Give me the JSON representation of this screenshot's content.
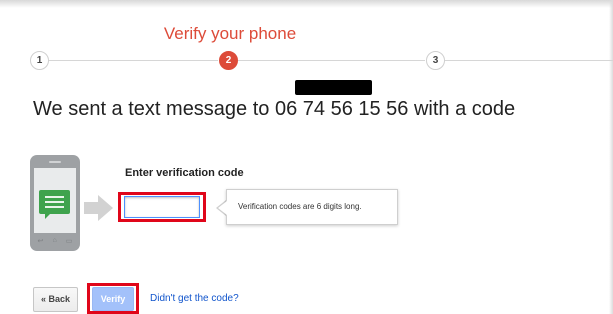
{
  "header": {
    "title": "Verify your phone"
  },
  "stepper": {
    "steps": [
      "1",
      "2",
      "3"
    ],
    "active_step": 2
  },
  "headline": "We sent a text message to 06 74 56 15 56 with a code",
  "form": {
    "label": "Enter verification code",
    "code_value": "",
    "hint": "Verification codes are 6 digits long."
  },
  "actions": {
    "back_label": "« Back",
    "verify_label": "Verify",
    "resend_link": "Didn't get the code?"
  },
  "colors": {
    "accent": "#dd4b39",
    "highlight": "#e0061a",
    "primary_button": "#a3c1fa",
    "link": "#1155cc",
    "message_green": "#3fa34d"
  },
  "icons": {
    "illustration": "phone-icon",
    "message": "chat-bubble-icon",
    "arrow": "arrow-right-icon"
  }
}
